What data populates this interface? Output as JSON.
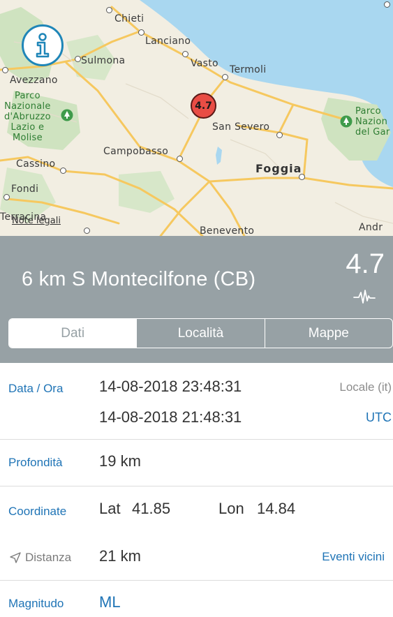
{
  "map": {
    "cities": {
      "chieti": "Chieti",
      "lanciano": "Lanciano",
      "sulmona": "Sulmona",
      "vasto": "Vasto",
      "termoli": "Termoli",
      "avezzano": "Avezzano",
      "san_severo": "San Severo",
      "campobasso": "Campobasso",
      "foggia": "Foggia",
      "cassino": "Cassino",
      "fondi": "Fondi",
      "terracina": "Terracina",
      "benevento": "Benevento",
      "andria": "Andr"
    },
    "parks": {
      "abruzzo_line1": "Parco",
      "abruzzo_line2": "Nazionale",
      "abruzzo_line3": "d'Abruzzo",
      "abruzzo_line4": "Lazio e",
      "abruzzo_line5": "Molise",
      "gargano_line1": "Parco",
      "gargano_line2": "Nazion",
      "gargano_line3": "del Gar"
    },
    "legal_link": "Note legali",
    "marker_magnitude": "4.7",
    "info_icon": "info-icon"
  },
  "event": {
    "title": "6 km S Montecilfone (CB)",
    "magnitude": "4.7"
  },
  "tabs": [
    {
      "label": "Dati",
      "selected": true
    },
    {
      "label": "Località",
      "selected": false
    },
    {
      "label": "Mappe",
      "selected": false
    }
  ],
  "details": {
    "datetime_label": "Data / Ora",
    "local_time": "14-08-2018 23:48:31",
    "local_tz": "Locale (it)",
    "utc_time": "14-08-2018 21:48:31",
    "utc_tz": "UTC",
    "depth_label": "Profondità",
    "depth_value": "19 km",
    "coord_label": "Coordinate",
    "lat_label": "Lat",
    "lat_value": "41.85",
    "lon_label": "Lon",
    "lon_value": "14.84",
    "distance_label": "Distanza",
    "distance_value": "21 km",
    "nearby_link": "Eventi vicini",
    "magnitude_label": "Magnitudo",
    "magnitude_type": "ML"
  },
  "colors": {
    "accent": "#1f74b6",
    "header_bg": "#97a1a5",
    "marker": "#e94d45",
    "sea": "#a9d7f0"
  }
}
